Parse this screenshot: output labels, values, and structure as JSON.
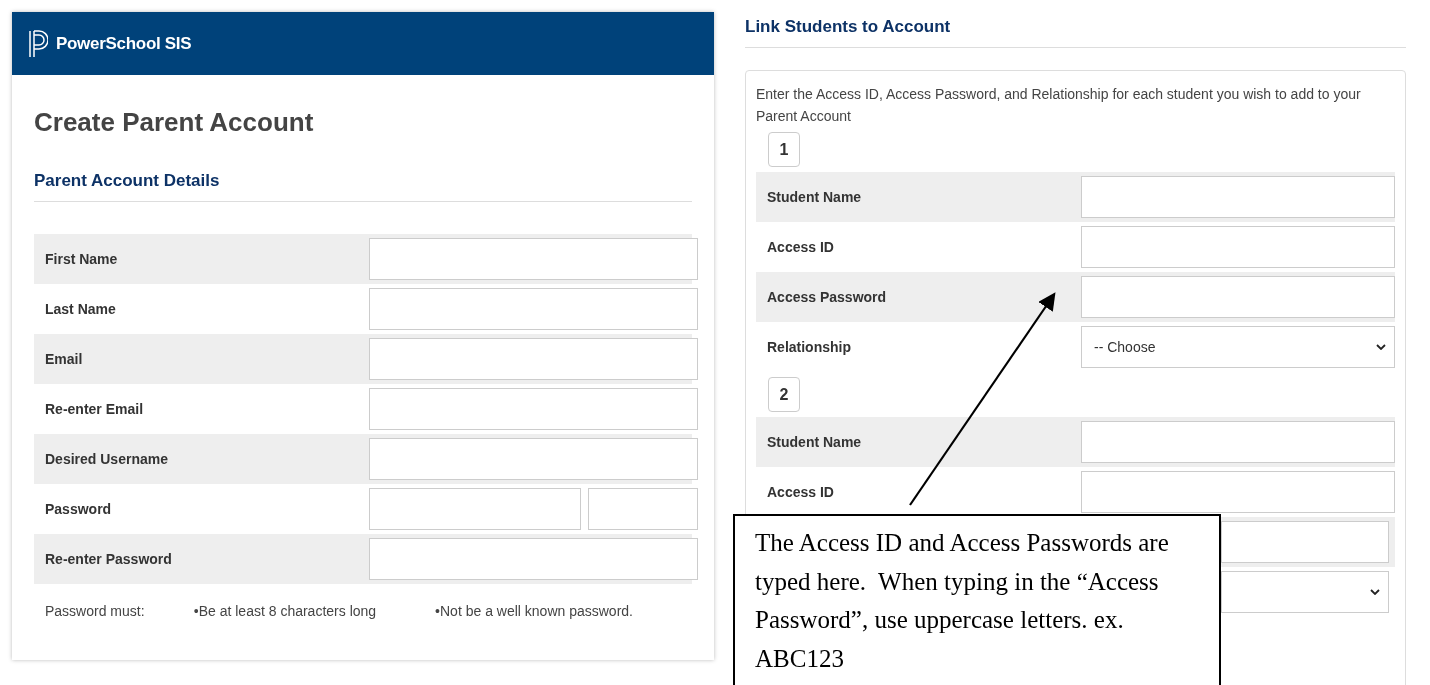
{
  "header": {
    "brand": "PowerSchool SIS"
  },
  "left": {
    "title": "Create Parent Account",
    "section": "Parent Account Details",
    "rows": [
      {
        "label": "First Name",
        "kind": "single"
      },
      {
        "label": "Last Name",
        "kind": "single"
      },
      {
        "label": "Email",
        "kind": "single"
      },
      {
        "label": "Re-enter Email",
        "kind": "single"
      },
      {
        "label": "Desired Username",
        "kind": "single"
      },
      {
        "label": "Password",
        "kind": "split"
      },
      {
        "label": "Re-enter Password",
        "kind": "single"
      }
    ],
    "hint": {
      "label": "Password must:",
      "rules": [
        "•Be at least 8 characters long",
        "•Not be a well known password."
      ]
    }
  },
  "right": {
    "section": "Link Students to Account",
    "intro": "Enter the Access ID, Access Password, and Relationship for each student you wish to add to your Parent Account",
    "students": [
      {
        "number": "1",
        "rows": [
          {
            "label": "Student Name",
            "kind": "text"
          },
          {
            "label": "Access ID",
            "kind": "text"
          },
          {
            "label": "Access Password",
            "kind": "text"
          },
          {
            "label": "Relationship",
            "kind": "select",
            "value": "-- Choose"
          }
        ]
      },
      {
        "number": "2",
        "rows": [
          {
            "label": "Student Name",
            "kind": "text"
          },
          {
            "label": "Access ID",
            "kind": "text"
          },
          {
            "kind": "text"
          },
          {
            "kind": "select"
          }
        ]
      }
    ]
  },
  "callout": {
    "text": "The Access ID and Access Passwords are typed here.  When typing in the “Access Password”, use uppercase letters. ex. ABC123"
  }
}
